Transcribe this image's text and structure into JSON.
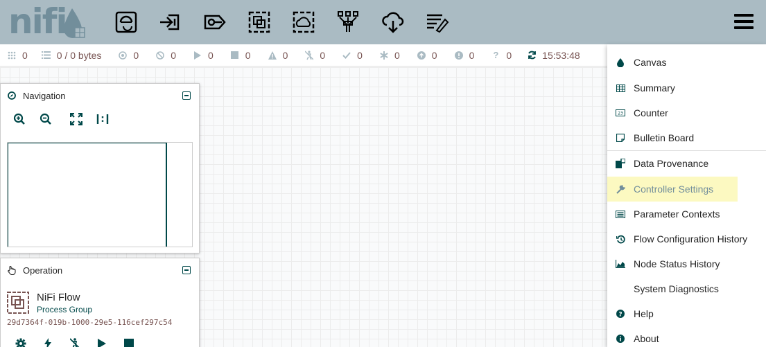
{
  "header": {
    "logo_text": "nifi",
    "toolbar": [
      {
        "name": "processor-icon"
      },
      {
        "name": "input-port-icon"
      },
      {
        "name": "output-port-icon"
      },
      {
        "name": "process-group-icon"
      },
      {
        "name": "remote-process-group-icon"
      },
      {
        "name": "funnel-icon"
      },
      {
        "name": "template-icon"
      },
      {
        "name": "label-icon"
      }
    ]
  },
  "status": {
    "threads": "0",
    "queued": "0 / 0 bytes",
    "transmitting": "0",
    "not_transmitting": "0",
    "running": "0",
    "stopped": "0",
    "invalid": "0",
    "disabled": "0",
    "up_to_date": "0",
    "locally_modified": "0",
    "stale": "0",
    "locally_modified_stale": "0",
    "sync_failure": "0",
    "refresh_time": "15:53:48"
  },
  "navigation": {
    "title": "Navigation"
  },
  "operation": {
    "title": "Operation",
    "name": "NiFi Flow",
    "type": "Process Group",
    "id": "29d7364f-019b-1000-29e5-116cef297c54"
  },
  "menu": {
    "items": [
      {
        "label": "Canvas",
        "icon": "drop-icon"
      },
      {
        "label": "Summary",
        "icon": "table-icon"
      },
      {
        "label": "Counter",
        "icon": "counter-icon"
      },
      {
        "label": "Bulletin Board",
        "icon": "sticky-note-icon"
      },
      {
        "label": "Data Provenance",
        "icon": "provenance-icon"
      },
      {
        "label": "Controller Settings",
        "icon": "wrench-icon"
      },
      {
        "label": "Parameter Contexts",
        "icon": "list-icon"
      },
      {
        "label": "Flow Configuration History",
        "icon": "history-icon"
      },
      {
        "label": "Node Status History",
        "icon": "area-chart-icon"
      },
      {
        "label": "System Diagnostics",
        "icon": ""
      },
      {
        "label": "Help",
        "icon": "question-icon"
      },
      {
        "label": "About",
        "icon": "info-icon"
      }
    ]
  },
  "colors": {
    "header_bg": "#aabbc3",
    "accent": "#004849",
    "status_value": "#775351",
    "highlight": "#fcf9c1"
  }
}
